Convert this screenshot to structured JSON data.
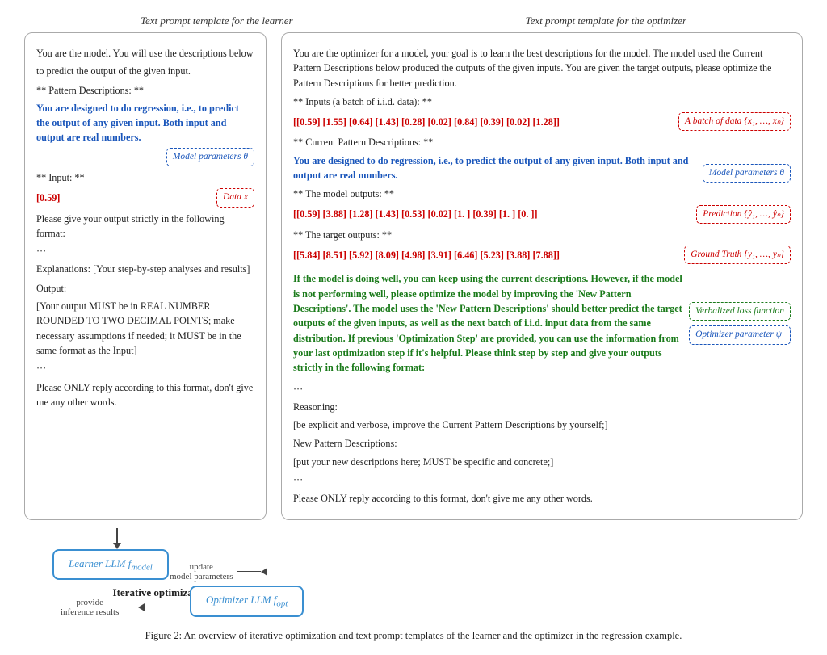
{
  "top_labels": {
    "left": "Text prompt template for the learner",
    "right": "Text prompt template for the optimizer"
  },
  "left_panel": {
    "line1": "You are the model. You will use the descriptions below",
    "line2": "to predict the output of the given input.",
    "line3": "",
    "pattern_header": "** Pattern Descriptions: **",
    "pattern_blue": "You are designed to do regression, i.e., to predict the output of any given input. Both input and output are real numbers.",
    "annot_model_params": "Model parameters θ",
    "input_header": "** Input: **",
    "input_value": "[0.59]",
    "annot_data_x": "Data x",
    "format_line": "Please give your output strictly in the following format:",
    "dots1": "···",
    "explanations": "Explanations: [Your step-by-step analyses and results]",
    "output_label": "Output:",
    "output_desc": "[Your output MUST be in REAL NUMBER ROUNDED TO TWO DECIMAL POINTS; make necessary assumptions if needed; it MUST be in the same format as the Input]",
    "dots2": "···",
    "reply_line": "Please ONLY reply according to this format, don't give me any other words."
  },
  "right_panel": {
    "intro": "You are the optimizer for a model, your goal is to learn the best descriptions for the model. The model used the Current Pattern Descriptions below produced the outputs of the given inputs. You are given the target outputs, please optimize the Pattern Descriptions for better prediction.",
    "inputs_header": "** Inputs (a batch of i.i.d. data): **",
    "inputs_value": "[[0.59] [1.55] [0.64] [1.43] [0.28] [0.02] [0.84] [0.39] [0.02] [1.28]]",
    "annot_batch": "A batch of data {x₁, …, xₙ}",
    "current_header": "** Current Pattern Descriptions: **",
    "current_blue": "You are designed to do regression, i.e., to predict the output of any given input. Both input and output are real numbers.",
    "annot_model_params": "Model parameters θ",
    "model_outputs_header": "** The model outputs: **",
    "model_outputs_value": "[[0.59] [3.88] [1.28] [1.43] [0.53] [0.02] [1. ] [0.39] [1. ] [0. ]]",
    "annot_prediction": "Prediction {ŷ₁, …, ŷₙ}",
    "target_header": "** The target outputs: **",
    "target_value": "[[5.84] [8.51] [5.92] [8.09] [4.98] [3.91] [6.46] [5.23] [3.88] [7.88]]",
    "annot_ground_truth": "Ground Truth {y₁, …, yₙ}",
    "optimizer_desc": "If the model is doing well, you can keep using the current descriptions. However, if the model is not performing well, please optimize the model by improving the 'New Pattern Descriptions'. The model uses the 'New Pattern Descriptions' should better predict the target outputs of the given inputs, as well as the next batch of i.i.d. input data from the same distribution. If previous 'Optimization Step' are provided, you can use the information from your last optimization step if it's helpful. Please think step by step and give your outputs strictly in the following format:",
    "annot_optimizer_param": "Optimizer parameter ψ",
    "annot_verbalized": "Verbalized loss function",
    "dots1": "···",
    "reasoning_label": "Reasoning:",
    "reasoning_desc": "[be explicit and verbose, improve the Current Pattern Descriptions by yourself;]",
    "new_pattern_label": "New Pattern Descriptions:",
    "new_pattern_desc": "[put your new descriptions here; MUST be specific and concrete;]",
    "dots2": "···",
    "reply_line": "Please ONLY reply according to this format, don't give me any other words."
  },
  "bottom": {
    "learner_label": "Learner LLM fmodel",
    "optimizer_label": "Optimizer LLM fopt",
    "iterative_label": "Iterative optimization",
    "update_label": "update\nmodel parameters",
    "provide_label": "provide\ninference results"
  },
  "caption": "Figure 2: An overview of iterative optimization and text prompt templates of the learner and the optimizer in the regression example."
}
